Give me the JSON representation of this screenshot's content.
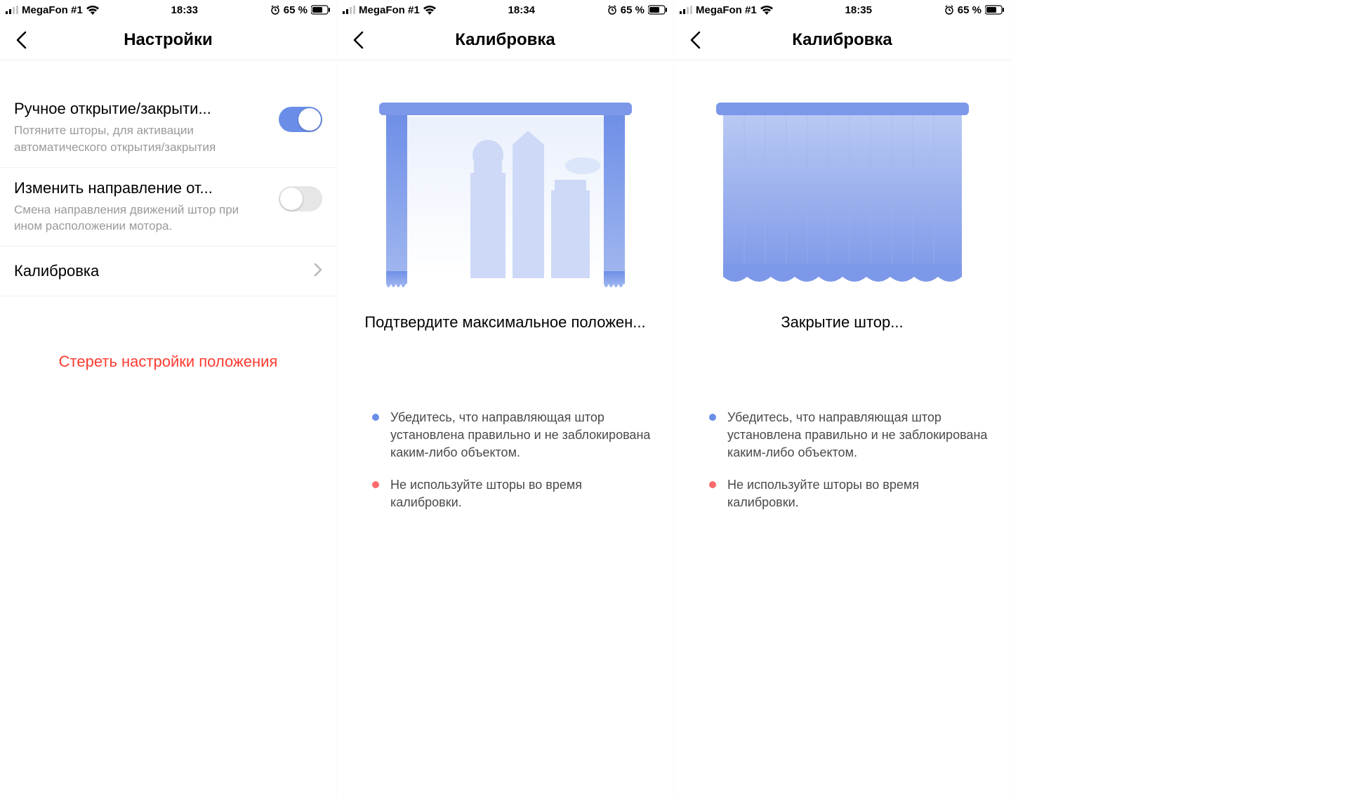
{
  "status": {
    "carrier": "MegaFon #1",
    "battery_text": "65 %"
  },
  "screens": [
    {
      "time": "18:33",
      "title": "Настройки",
      "settings": {
        "manual": {
          "title": "Ручное открытие/закрыти...",
          "desc": "Потяните шторы, для активации автоматического открытия/закрытия",
          "on": true
        },
        "direction": {
          "title": "Изменить направление от...",
          "desc": "Смена направления движений штор при ином расположении мотора.",
          "on": false
        },
        "calibration_label": "Калибровка"
      },
      "erase_label": "Стереть настройки положения"
    },
    {
      "time": "18:34",
      "title": "Калибровка",
      "calib_heading": "Подтвердите максимальное положен...",
      "curtain_state": "open",
      "bullets": [
        {
          "color": "blue",
          "text": "Убедитесь, что направляющая штор установлена правильно и не заблокирована каким-либо объектом."
        },
        {
          "color": "red",
          "text": "Не используйте шторы во время калибровки."
        }
      ]
    },
    {
      "time": "18:35",
      "title": "Калибровка",
      "calib_heading": "Закрытие штор...",
      "curtain_state": "closed",
      "bullets": [
        {
          "color": "blue",
          "text": "Убедитесь, что направляющая штор установлена правильно и не заблокирована каким-либо объектом."
        },
        {
          "color": "red",
          "text": "Не используйте шторы во время калибровки."
        }
      ]
    }
  ]
}
